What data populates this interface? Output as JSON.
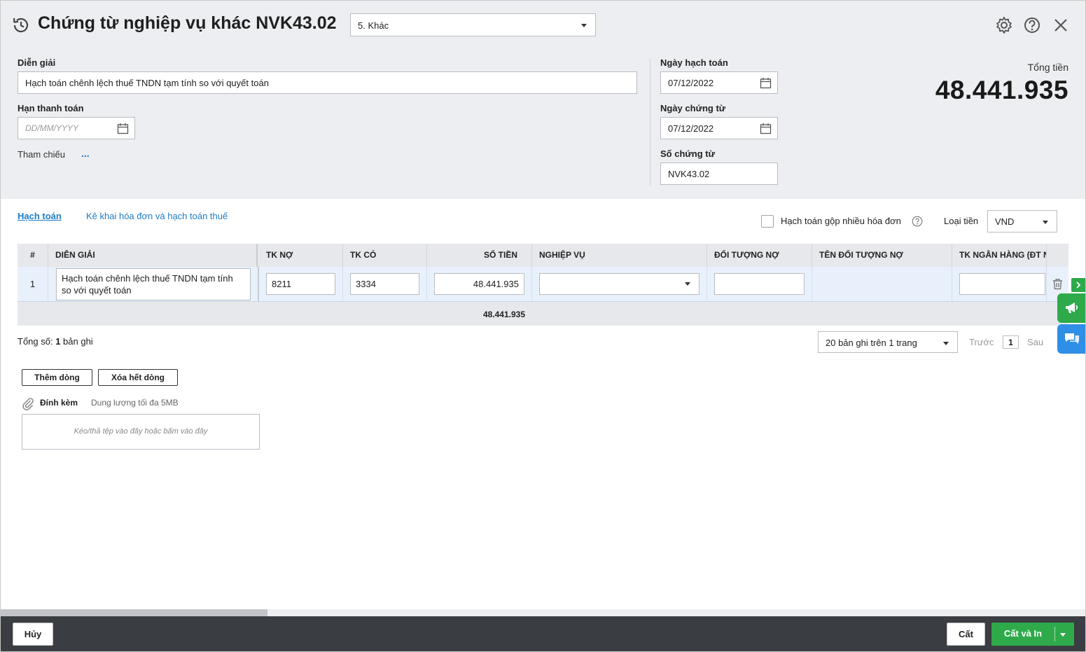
{
  "header": {
    "title": "Chứng từ nghiệp vụ khác NVK43.02",
    "voucher_type": "5. Khác"
  },
  "form": {
    "description_label": "Diễn giải",
    "description_value": "Hạch toán chênh lệch thuế TNDN tạm tính so với quyết toán",
    "due_date_label": "Hạn thanh toán",
    "due_date_placeholder": "DD/MM/YYYY",
    "reference_label": "Tham chiếu",
    "reference_more": "...",
    "posting_date_label": "Ngày hạch toán",
    "posting_date_value": "07/12/2022",
    "voucher_date_label": "Ngày chứng từ",
    "voucher_date_value": "07/12/2022",
    "voucher_no_label": "Số chứng từ",
    "voucher_no_value": "NVK43.02",
    "total_label": "Tổng tiền",
    "total_value": "48.441.935"
  },
  "tabs": [
    {
      "label": "Hạch toán",
      "active": true
    },
    {
      "label": "Kê khai hóa đơn và hạch toán thuế",
      "active": false
    }
  ],
  "options": {
    "merge_invoices_label": "Hạch toán gộp nhiều hóa đơn",
    "merge_invoices_checked": false,
    "currency_label": "Loại tiền",
    "currency_value": "VND"
  },
  "grid": {
    "columns": [
      "#",
      "DIỄN GIẢI",
      "TK NỢ",
      "TK CÓ",
      "SỐ TIỀN",
      "NGHIỆP VỤ",
      "ĐỐI TƯỢNG NỢ",
      "TÊN ĐỐI TƯỢNG NỢ",
      "TK NGÂN HÀNG (ĐT N"
    ],
    "rows": [
      {
        "index": "1",
        "description": "Hạch toán chênh lệch thuế TNDN tạm tính so với quyết toán",
        "debit_account": "8211",
        "credit_account": "3334",
        "amount": "48.441.935",
        "operation": "",
        "debtor": "",
        "debtor_name": "",
        "bank_account": ""
      }
    ],
    "sum_amount": "48.441.935"
  },
  "paging": {
    "total_prefix": "Tổng số: ",
    "total_count": "1",
    "total_suffix": " bản ghi",
    "page_size": "20 bản ghi trên 1 trang",
    "prev": "Trước",
    "page": "1",
    "next": "Sau"
  },
  "actions": {
    "add_row": "Thêm dòng",
    "clear_rows": "Xóa hết dòng"
  },
  "attachment": {
    "label": "Đính kèm",
    "hint": "Dung lượng tối đa 5MB",
    "dropzone": "Kéo/thả tệp vào đây hoặc bấm vào đây"
  },
  "footer": {
    "cancel": "Hủy",
    "save": "Cất",
    "save_print": "Cất và In"
  },
  "colors": {
    "accent_blue": "#1e7bc4",
    "primary_green": "#2eaa4a",
    "chat_blue": "#2f8fe6",
    "footer_bg": "#3a3d41",
    "header_bg": "#eceef1"
  }
}
